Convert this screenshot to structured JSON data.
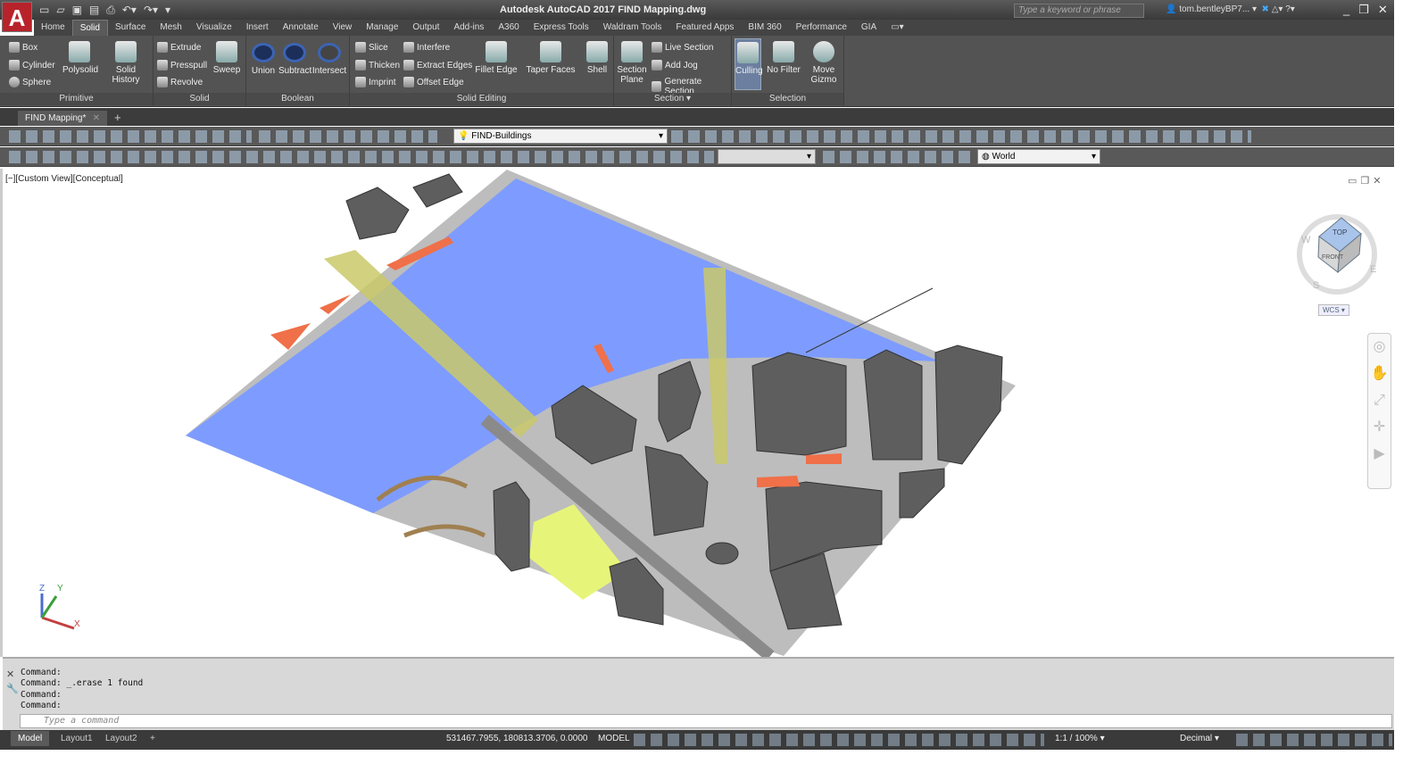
{
  "app": {
    "title": "Autodesk AutoCAD 2017   FIND Mapping.dwg",
    "logo": "A",
    "search_placeholder": "Type a keyword or phrase",
    "user": "tom.bentleyBP7..."
  },
  "ribbon_tabs": [
    "Home",
    "Solid",
    "Surface",
    "Mesh",
    "Visualize",
    "Insert",
    "Annotate",
    "View",
    "Manage",
    "Output",
    "Add-ins",
    "A360",
    "Express Tools",
    "Waldram Tools",
    "Featured Apps",
    "BIM 360",
    "Performance",
    "GIA"
  ],
  "active_tab": "Solid",
  "panels": {
    "primitive": {
      "label": "Primitive",
      "items": [
        "Box",
        "Cylinder",
        "Sphere"
      ],
      "big": [
        "Polysolid",
        "Solid History"
      ]
    },
    "solid": {
      "label": "Solid",
      "items": [
        "Extrude",
        "Presspull",
        "Revolve"
      ],
      "big": [
        "Sweep"
      ]
    },
    "boolean": {
      "label": "Boolean",
      "big": [
        "Union",
        "Subtract",
        "Intersect"
      ]
    },
    "solid_editing": {
      "label": "Solid Editing",
      "items": [
        "Slice",
        "Thicken",
        "Imprint",
        "Interfere",
        "Extract Edges",
        "Offset Edge"
      ],
      "big": [
        "Fillet Edge",
        "Taper Faces",
        "Shell"
      ]
    },
    "section": {
      "label": "Section",
      "big": [
        "Section",
        "Plane"
      ],
      "items": [
        "Live Section",
        "Add Jog",
        "Generate Section"
      ]
    },
    "selection": {
      "label": "Selection",
      "big": [
        "Culling",
        "No Filter",
        "Move",
        "Gizmo"
      ]
    }
  },
  "file_tab": "FIND Mapping*",
  "layer_combo": "FIND-Buildings",
  "ucs_combo": "World",
  "viewport": {
    "label": "[−][Custom View][Conceptual]",
    "wcs": "WCS",
    "viewcube": {
      "top": "TOP",
      "front": "FRONT",
      "w": "W",
      "s": "S",
      "e": "E"
    }
  },
  "command": {
    "lines": [
      "Command:",
      "Command: _.erase 1 found",
      "Command:",
      "Command:"
    ],
    "placeholder": "Type a command"
  },
  "layouts": [
    "Model",
    "Layout1",
    "Layout2",
    "+"
  ],
  "status": {
    "coords": "531467.7955, 180813.3706, 0.0000",
    "space": "MODEL",
    "scale": "1:1 / 100%",
    "units": "Decimal"
  }
}
